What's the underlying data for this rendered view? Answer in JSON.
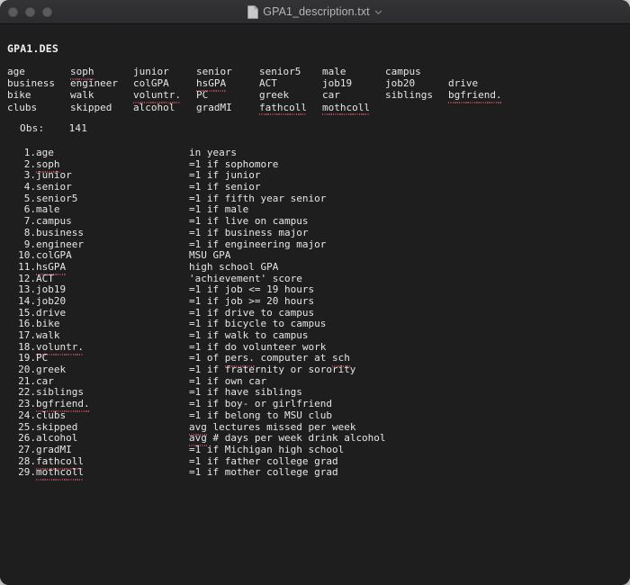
{
  "window": {
    "title": "GPA1_description.txt",
    "doc_icon": "document-icon",
    "chevron_icon": "chevron-down-icon",
    "traffic_lights": [
      "close-button",
      "minimize-button",
      "zoom-button"
    ],
    "colors": {
      "titlebar_bg": "#2f2f32",
      "content_bg": "#1e1e1e",
      "text": "#e6e6e6",
      "title_text": "#b5b5b7",
      "traffic_inactive": "#5a5a5c",
      "squiggle": "#a24a55",
      "page_bg": "#d6d6d6"
    }
  },
  "document": {
    "file_header": "GPA1.DES",
    "obs_label": "Obs:",
    "obs_value": "141",
    "obs_line": "Obs:    141",
    "banner_rows": [
      [
        "age",
        "soph",
        "junior",
        "senior",
        "senior5",
        "male",
        "campus",
        ""
      ],
      [
        "business",
        "engineer",
        "colGPA",
        "hsGPA",
        "ACT",
        "job19",
        "job20",
        "drive"
      ],
      [
        "bike",
        "walk",
        "voluntr.",
        "PC",
        "greek",
        "car",
        "siblings",
        "bgfriend."
      ],
      [
        "clubs",
        "skipped",
        "alcohol",
        "gradMI",
        "fathcoll",
        "mothcoll",
        "",
        ""
      ]
    ],
    "banner_misspelled": [
      "soph",
      "hsGPA",
      "voluntr.",
      "bgfriend.",
      "fathcoll",
      "mothcoll"
    ],
    "variables": [
      {
        "num": "1.",
        "name": "age",
        "desc": "in years",
        "name_flag": false,
        "desc_flag": ""
      },
      {
        "num": "2.",
        "name": "soph",
        "desc": "=1 if sophomore",
        "name_flag": true,
        "desc_flag": ""
      },
      {
        "num": "3.",
        "name": "junior",
        "desc": "=1 if junior",
        "name_flag": false,
        "desc_flag": ""
      },
      {
        "num": "4.",
        "name": "senior",
        "desc": "=1 if senior",
        "name_flag": false,
        "desc_flag": ""
      },
      {
        "num": "5.",
        "name": "senior5",
        "desc": "=1 if fifth year senior",
        "name_flag": false,
        "desc_flag": ""
      },
      {
        "num": "6.",
        "name": "male",
        "desc": "=1 if male",
        "name_flag": false,
        "desc_flag": ""
      },
      {
        "num": "7.",
        "name": "campus",
        "desc": "=1 if live on campus",
        "name_flag": false,
        "desc_flag": ""
      },
      {
        "num": "8.",
        "name": "business",
        "desc": "=1 if business major",
        "name_flag": false,
        "desc_flag": ""
      },
      {
        "num": "9.",
        "name": "engineer",
        "desc": "=1 if engineering major",
        "name_flag": false,
        "desc_flag": ""
      },
      {
        "num": "10.",
        "name": "colGPA",
        "desc": "MSU GPA",
        "name_flag": false,
        "desc_flag": ""
      },
      {
        "num": "11.",
        "name": "hsGPA",
        "desc": "high school GPA",
        "name_flag": true,
        "desc_flag": ""
      },
      {
        "num": "12.",
        "name": "ACT",
        "desc": "'achievement' score",
        "name_flag": false,
        "desc_flag": ""
      },
      {
        "num": "13.",
        "name": "job19",
        "desc": "=1 if job <= 19 hours",
        "name_flag": false,
        "desc_flag": ""
      },
      {
        "num": "14.",
        "name": "job20",
        "desc": "=1 if job >= 20 hours",
        "name_flag": false,
        "desc_flag": ""
      },
      {
        "num": "15.",
        "name": "drive",
        "desc": "=1 if drive to campus",
        "name_flag": false,
        "desc_flag": ""
      },
      {
        "num": "16.",
        "name": "bike",
        "desc": "=1 if bicycle to campus",
        "name_flag": false,
        "desc_flag": ""
      },
      {
        "num": "17.",
        "name": "walk",
        "desc": "=1 if walk to campus",
        "name_flag": false,
        "desc_flag": ""
      },
      {
        "num": "18.",
        "name": "voluntr.",
        "desc": "=1 if do volunteer work",
        "name_flag": true,
        "desc_flag": ""
      },
      {
        "num": "19.",
        "name": "PC",
        "desc": "=1 of pers. computer at sch",
        "name_flag": false,
        "desc_flag": "pers-sch"
      },
      {
        "num": "20.",
        "name": "greek",
        "desc": "=1 if fraternity or sorority",
        "name_flag": false,
        "desc_flag": ""
      },
      {
        "num": "21.",
        "name": "car",
        "desc": "=1 if own car",
        "name_flag": false,
        "desc_flag": ""
      },
      {
        "num": "22.",
        "name": "siblings",
        "desc": "=1 if have siblings",
        "name_flag": false,
        "desc_flag": ""
      },
      {
        "num": "23.",
        "name": "bgfriend.",
        "desc": "=1 if boy- or girlfriend",
        "name_flag": true,
        "desc_flag": ""
      },
      {
        "num": "24.",
        "name": "clubs",
        "desc": "=1 if belong to MSU club",
        "name_flag": false,
        "desc_flag": ""
      },
      {
        "num": "25.",
        "name": "skipped",
        "desc": "avg lectures missed per week",
        "name_flag": false,
        "desc_flag": "avg"
      },
      {
        "num": "26.",
        "name": "alcohol",
        "desc": "avg # days per week drink alcohol",
        "name_flag": false,
        "desc_flag": "avg"
      },
      {
        "num": "27.",
        "name": "gradMI",
        "desc": "=1 if Michigan high school",
        "name_flag": false,
        "desc_flag": ""
      },
      {
        "num": "28.",
        "name": "fathcoll",
        "desc": "=1 if father college grad",
        "name_flag": true,
        "desc_flag": ""
      },
      {
        "num": "29.",
        "name": "mothcoll",
        "desc": "=1 if mother college grad",
        "name_flag": true,
        "desc_flag": ""
      }
    ]
  }
}
